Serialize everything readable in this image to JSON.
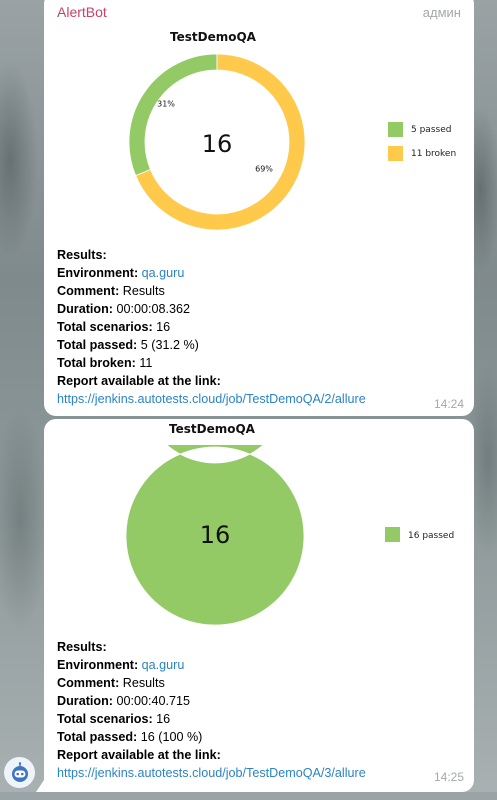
{
  "messages": [
    {
      "sender": "AlertBot",
      "role": "админ",
      "time": "14:24",
      "center_value": "16",
      "results_label": "Results:",
      "environment_label": "Environment:",
      "environment_value": "qa.guru",
      "comment_label": "Comment:",
      "comment_value": "Results",
      "duration_label": "Duration:",
      "duration_value": "00:00:08.362",
      "total_scenarios_label": "Total scenarios:",
      "total_scenarios_value": "16",
      "total_passed_label": "Total passed:",
      "total_passed_value": "5 (31.2 %)",
      "total_broken_label": "Total broken:",
      "total_broken_value": "11",
      "report_label": "Report available at the link:",
      "report_link": "https://jenkins.autotests.cloud/job/TestDemoQA/2/allure"
    },
    {
      "time": "14:25",
      "center_value": "16",
      "results_label": "Results:",
      "environment_label": "Environment:",
      "environment_value": "qa.guru",
      "comment_label": "Comment:",
      "comment_value": "Results",
      "duration_label": "Duration:",
      "duration_value": "00:00:40.715",
      "total_scenarios_label": "Total scenarios:",
      "total_scenarios_value": "16",
      "total_passed_label": "Total passed:",
      "total_passed_value": "16 (100 %)",
      "report_label": "Report available at the link:",
      "report_link": "https://jenkins.autotests.cloud/job/TestDemoQA/3/allure"
    }
  ],
  "chart_data": [
    {
      "type": "pie",
      "title": "TestDemoQA",
      "series": [
        {
          "values": [
            5,
            11
          ]
        }
      ],
      "categories": [
        "passed",
        "broken"
      ],
      "legend": [
        "5 passed",
        "11 broken"
      ],
      "data_labels": [
        "31%",
        "69%"
      ],
      "colors": [
        "#94ca66",
        "#ffc94c"
      ],
      "legend_position": "right"
    },
    {
      "type": "pie",
      "title": "TestDemoQA",
      "series": [
        {
          "values": [
            16
          ]
        }
      ],
      "categories": [
        "passed"
      ],
      "legend": [
        "16 passed"
      ],
      "data_labels": [],
      "colors": [
        "#94ca66"
      ],
      "legend_position": "right"
    }
  ],
  "icons": {
    "avatar": "robot-icon"
  }
}
